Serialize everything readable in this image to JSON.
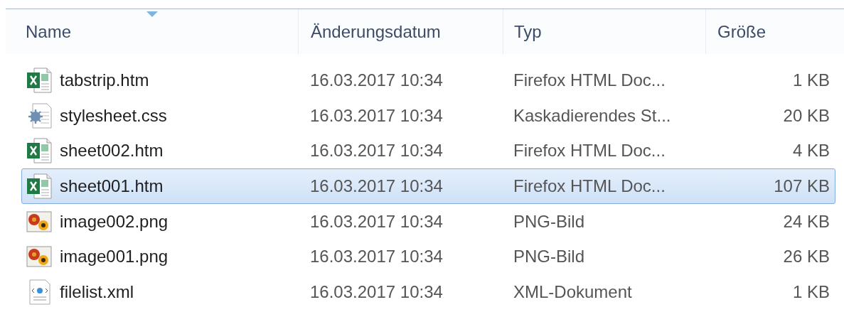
{
  "columns": [
    {
      "label": "Name",
      "sorted": true
    },
    {
      "label": "Änderungsdatum",
      "sorted": false
    },
    {
      "label": "Typ",
      "sorted": false
    },
    {
      "label": "Größe",
      "sorted": false
    }
  ],
  "rows": [
    {
      "kind": "excel",
      "name": "tabstrip.htm",
      "date": "16.03.2017 10:34",
      "type": "Firefox HTML Doc...",
      "size": "1 KB",
      "selected": false
    },
    {
      "kind": "css",
      "name": "stylesheet.css",
      "date": "16.03.2017 10:34",
      "type": "Kaskadierendes St...",
      "size": "20 KB",
      "selected": false
    },
    {
      "kind": "excel",
      "name": "sheet002.htm",
      "date": "16.03.2017 10:34",
      "type": "Firefox HTML Doc...",
      "size": "4 KB",
      "selected": false
    },
    {
      "kind": "excel",
      "name": "sheet001.htm",
      "date": "16.03.2017 10:34",
      "type": "Firefox HTML Doc...",
      "size": "107 KB",
      "selected": true
    },
    {
      "kind": "image",
      "name": "image002.png",
      "date": "16.03.2017 10:34",
      "type": "PNG-Bild",
      "size": "24 KB",
      "selected": false
    },
    {
      "kind": "image",
      "name": "image001.png",
      "date": "16.03.2017 10:34",
      "type": "PNG-Bild",
      "size": "26 KB",
      "selected": false
    },
    {
      "kind": "xml",
      "name": "filelist.xml",
      "date": "16.03.2017 10:34",
      "type": "XML-Dokument",
      "size": "1 KB",
      "selected": false
    }
  ]
}
